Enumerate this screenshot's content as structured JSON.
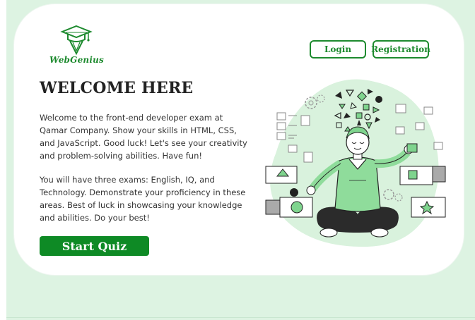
{
  "brand": {
    "name": "WebGenius",
    "accent": "#1d8a2e",
    "background": "#ddf3e2"
  },
  "header": {
    "login_label": "Login",
    "registration_label": "Registration"
  },
  "main": {
    "title": "WELCOME HERE",
    "paragraph1": "Welcome to the front-end developer exam at Qamar Company. Show your skills in HTML, CSS, and JavaScript. Good luck! Let's see your creativity and problem-solving abilities. Have fun!",
    "paragraph2": "You will have three exams: English, IQ, and Technology. Demonstrate your proficiency in these areas. Best of luck in showcasing your knowledge and abilities. Do your best!",
    "start_label": "Start Quiz"
  },
  "icons": {
    "logo": "graduation-cap-pencil-icon",
    "illustration": "meditating-developer-illustration"
  }
}
